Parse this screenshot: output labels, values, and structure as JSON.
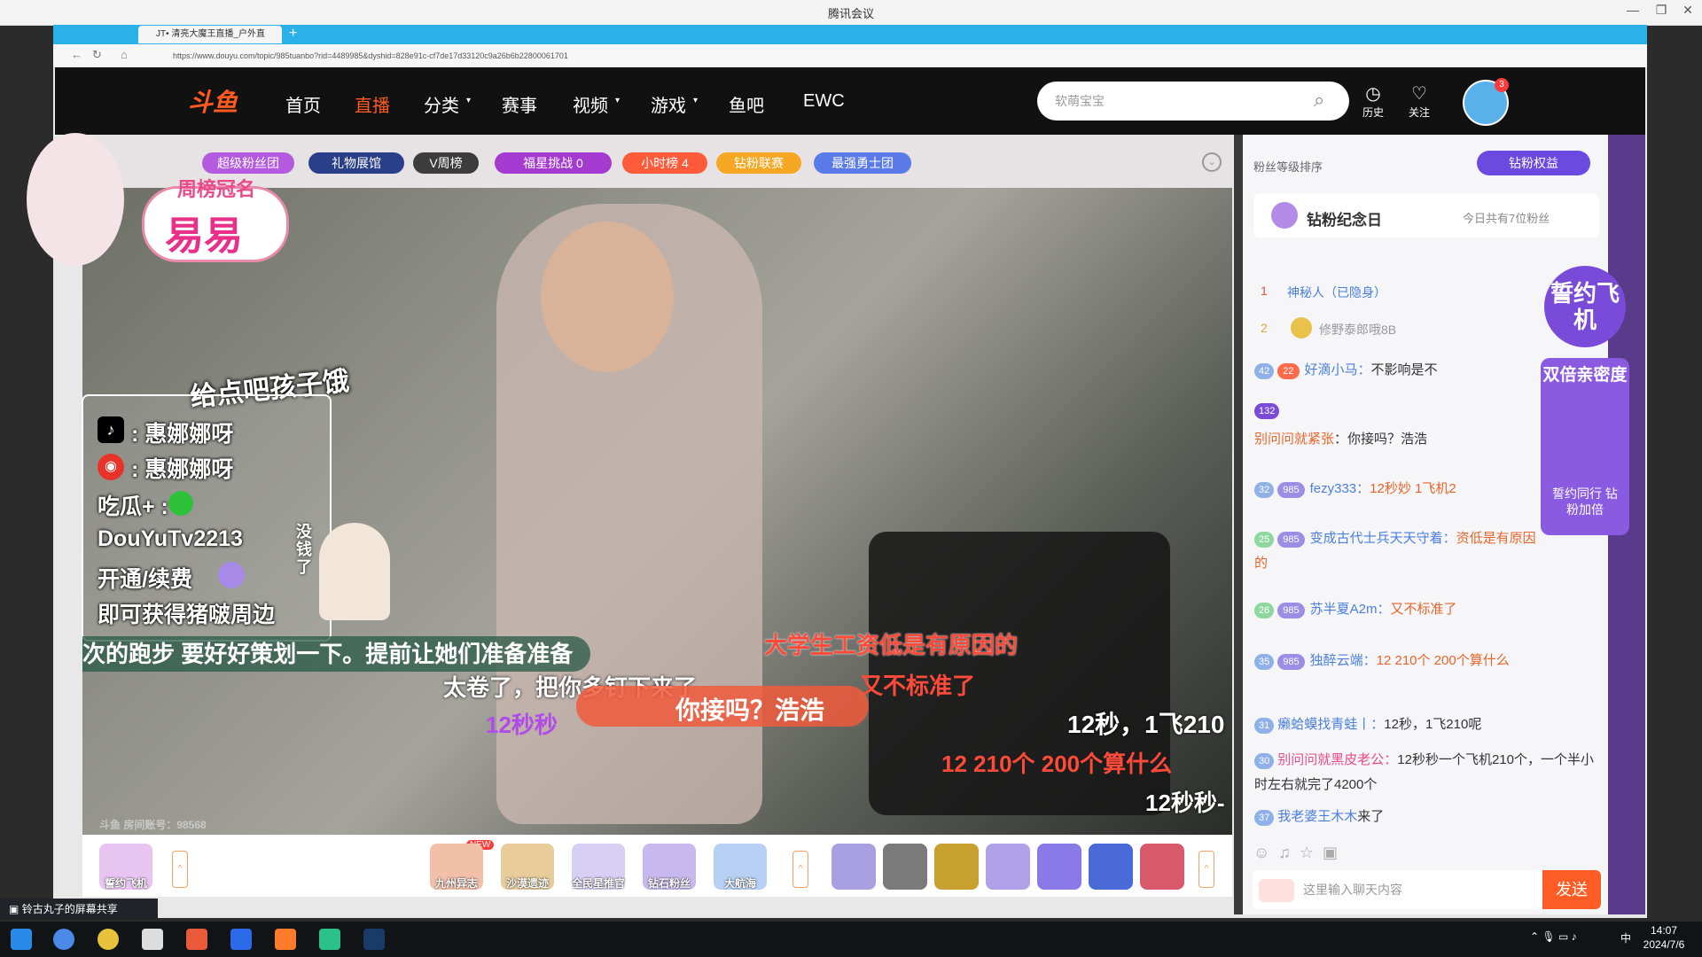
{
  "window": {
    "title": "腾讯会议"
  },
  "browser": {
    "tab_title": "JT• 清亮大魔王直播_户外直",
    "url": "https://www.douyu.com/topic/985tuanbo?rid=4489985&dyshid=828e91c-cf7de17d33120c9a26b6b22800061701"
  },
  "site": {
    "logo": "斗鱼",
    "nav": [
      "首页",
      "直播",
      "分类",
      "赛事",
      "视频",
      "游戏",
      "鱼吧",
      "EWC"
    ],
    "active_nav": "直播",
    "search_placeholder": "软萌宝宝",
    "history_label": "历史",
    "follow_label": "关注",
    "avatar_badge": "3"
  },
  "player": {
    "badges": [
      "超级粉丝团",
      "礼物展馆",
      "V周榜",
      "福星挑战 0",
      "小时榜 4",
      "钻粉联赛",
      "最强勇士团"
    ],
    "weekly_champion_label": "周榜冠名",
    "weekly_champion_name": "易易",
    "overlay_tag": "给点吧孩子饿",
    "info_lines": [
      ": 惠娜娜呀",
      ": 惠娜娜呀",
      "吃瓜+ :",
      "DouYuTv2213",
      "开通/续费",
      "即可获得猪啵周边"
    ],
    "side_text": "没钱了",
    "subtitle": "次的跑步 要好好策划一下。提前让她们准备准备",
    "danmaku": [
      {
        "text": "大学生工资低是有原因的",
        "color": "#ff4a3a"
      },
      {
        "text": "又不标准了",
        "color": "#ff4a3a"
      },
      {
        "text": "你接吗？浩浩",
        "color": "#ffffff"
      },
      {
        "text": "12秒，1飞210",
        "color": "#ffffff"
      },
      {
        "text": "12 210个 200个算什么",
        "color": "#ff4a3a"
      },
      {
        "text": "12秒秒",
        "color": "#b04ae8"
      },
      {
        "text": "12秒秒-",
        "color": "#ffffff"
      },
      {
        "text": "太卷了，把你多钉下来了",
        "color": "#ffffff"
      }
    ],
    "room_no": "斗鱼 房间账号：98568",
    "gifts": [
      {
        "label": "誓约飞机",
        "color": "#c86ad8"
      },
      {
        "label": "九州异志",
        "color": "#e04a2a"
      },
      {
        "label": "沙漠遗迹",
        "color": "#d88a2a"
      },
      {
        "label": "全民星推官",
        "color": "#9a8ae8"
      },
      {
        "label": "钻石粉丝",
        "color": "#7a5ad8"
      },
      {
        "label": "大航海",
        "color": "#3a7ad8"
      }
    ],
    "gift_new_badge": "NEW"
  },
  "panel": {
    "rank_title": "粉丝等级排序",
    "diamond_rights": "钻粉权益",
    "anniv_title": "钻粉纪念日",
    "anniv_count": "今日共有7位粉丝",
    "rank_rows": [
      {
        "rank": "1",
        "name": "神秘人（已隐身）"
      },
      {
        "rank": "2",
        "name": "修野泰郎哦8B"
      }
    ],
    "oath_badge": "誓约飞机",
    "double_label": "双倍亲密度",
    "double_sub": "誓约同行 钻粉加倍",
    "chats": [
      {
        "lvl": "42",
        "fan": "22",
        "nick": "好滴小马：",
        "msg": "不影响是不"
      },
      {
        "lvl": "132",
        "fan": "",
        "nick": "别问问就紧张",
        "msg": "你接吗？浩浩"
      },
      {
        "lvl": "32",
        "fan": "985",
        "nick": "fezy333：",
        "msg": "12秒妙 1飞机2"
      },
      {
        "lvl": "25",
        "fan": "985",
        "nick": "变成古代士兵天天守着：",
        "msg": "资低是有原因的"
      },
      {
        "lvl": "26",
        "fan": "985",
        "nick": "苏半夏A2m：",
        "msg": "又不标准了"
      },
      {
        "lvl": "35",
        "fan": "985",
        "nick": "独醉云端：",
        "msg": "12 210个 200个算什么"
      },
      {
        "lvl": "31",
        "fan": "",
        "nick": "癞蛤蟆找青蛙丨：",
        "msg": "12秒，1飞210呢"
      },
      {
        "lvl": "30",
        "fan": "",
        "nick": "别问问就黑皮老公：",
        "msg": "12秒秒一个飞机210个，一个半小时左右就完了4200个"
      },
      {
        "lvl": "37",
        "fan": "",
        "nick": "我老婆王木木",
        "msg": "来了"
      }
    ],
    "chat_placeholder": "这里输入聊天内容",
    "send_label": "发送"
  },
  "share_bar": {
    "text": "铃古丸子的屏幕共享"
  },
  "taskbar": {
    "time": "14:07",
    "date": "2024/7/6",
    "ime": "中"
  },
  "colors": {
    "accent": "#ff5a1f",
    "nav_active": "#ff5a1f",
    "header_bg": "#111111",
    "tab_bar": "#29b1e8"
  }
}
